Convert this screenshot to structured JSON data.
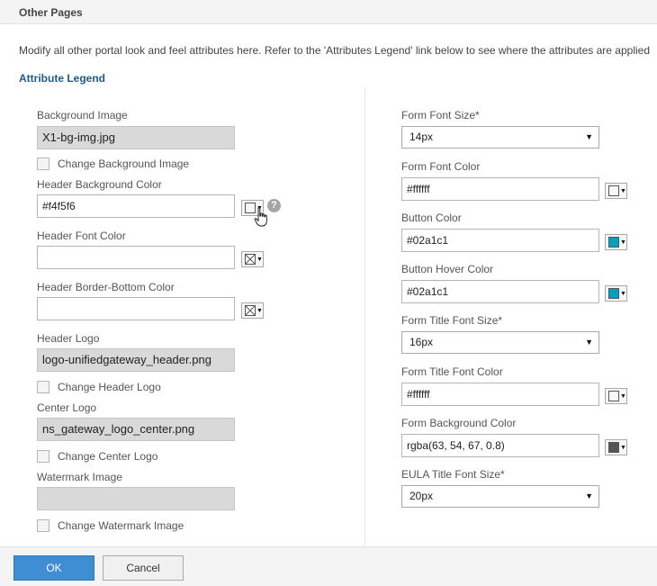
{
  "header": {
    "title": "Other Pages"
  },
  "description": "Modify all other portal look and feel attributes here. Refer to the 'Attributes Legend' link below to see where the attributes are applied",
  "legend_link": "Attribute Legend",
  "left": {
    "background_image": {
      "label": "Background Image",
      "value": "X1-bg-img.jpg",
      "checkbox": "Change Background Image"
    },
    "header_bg_color": {
      "label": "Header Background Color",
      "value": "#f4f5f6",
      "swatch": "#ffffff"
    },
    "header_font_color": {
      "label": "Header Font Color",
      "value": ""
    },
    "header_border_color": {
      "label": "Header Border-Bottom Color",
      "value": ""
    },
    "header_logo": {
      "label": "Header Logo",
      "value": "logo-unifiedgateway_header.png",
      "checkbox": "Change Header Logo"
    },
    "center_logo": {
      "label": "Center Logo",
      "value": "ns_gateway_logo_center.png",
      "checkbox": "Change Center Logo"
    },
    "watermark_image": {
      "label": "Watermark Image",
      "value": "",
      "checkbox": "Change Watermark Image"
    }
  },
  "right": {
    "form_font_size": {
      "label": "Form Font Size*",
      "value": "14px"
    },
    "form_font_color": {
      "label": "Form Font Color",
      "value": "#ffffff",
      "swatch": "#ffffff"
    },
    "button_color": {
      "label": "Button Color",
      "value": "#02a1c1",
      "swatch": "#02a1c1"
    },
    "button_hover_color": {
      "label": "Button Hover Color",
      "value": "#02a1c1",
      "swatch": "#02a1c1"
    },
    "form_title_font_size": {
      "label": "Form Title Font Size*",
      "value": "16px"
    },
    "form_title_font_color": {
      "label": "Form Title Font Color",
      "value": "#ffffff",
      "swatch": "#ffffff"
    },
    "form_bg_color": {
      "label": "Form Background Color",
      "value": "rgba(63, 54, 67, 0.8)",
      "swatch": "#3f3643"
    },
    "eula_title_font_size": {
      "label": "EULA Title Font Size*",
      "value": "20px"
    }
  },
  "icons": {
    "help": "?",
    "dropdown_arrow": "▼"
  },
  "footer": {
    "ok": "OK",
    "cancel": "Cancel"
  },
  "colors": {
    "accent": "#3f8ed3",
    "legend": "#1f5a8a"
  }
}
